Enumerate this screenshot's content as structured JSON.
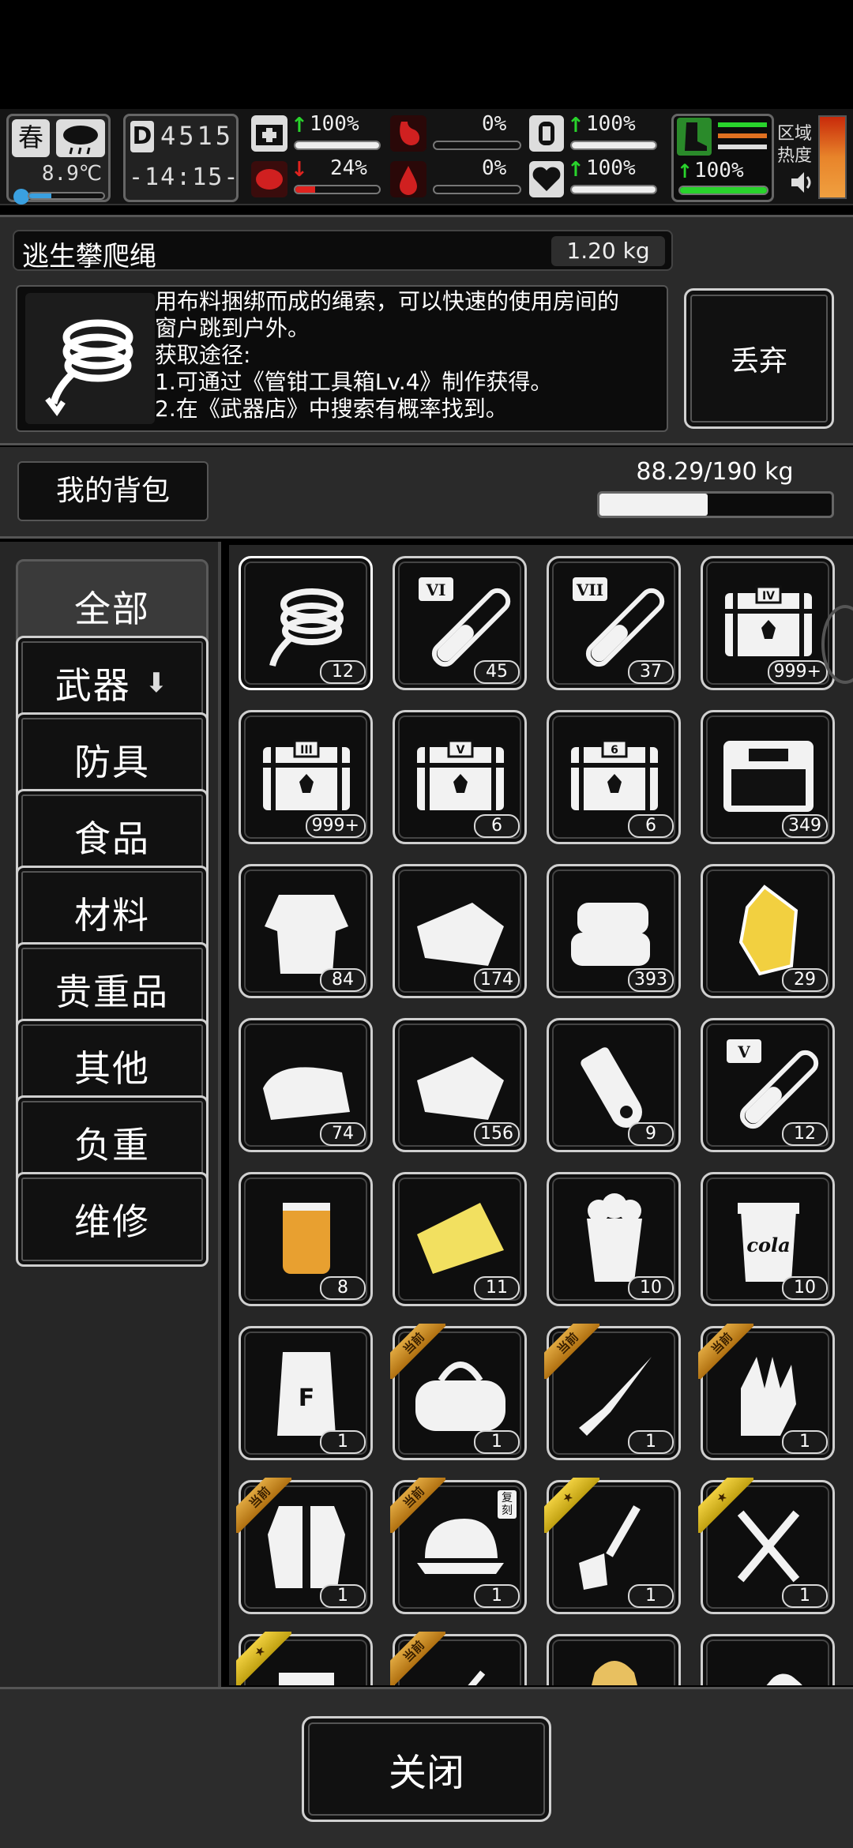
{
  "hud": {
    "season": "春",
    "temperature": "8.9℃",
    "day": "4515",
    "time": "-14:15-",
    "health_pct": "100%",
    "health_level": 1.0,
    "mental_pct": "24%",
    "mental_level": 0.24,
    "hunger_pct": "0%",
    "hunger_level": 0.0,
    "thirst_pct": "0%",
    "thirst_level": 0.0,
    "stamina_pct": "100%",
    "stamina_level": 1.0,
    "mood_pct": "100%",
    "mood_level": 1.0,
    "legs_pct": "100%",
    "legs_level": 1.0,
    "region_label": "区域热度",
    "colors": {
      "green": "#29d32c",
      "red": "#e0231f"
    }
  },
  "item": {
    "name": "逃生攀爬绳",
    "weight": "1.20 kg",
    "desc_lines": [
      "用布料捆绑而成的绳索，可以快速的使用房间的",
      "窗户跳到户外。",
      "获取途径:",
      "1.可通过《管钳工具箱Lv.4》制作获得。",
      "2.在《武器店》中搜索有概率找到。"
    ],
    "discard_label": "丢弃",
    "icon": "rope-icon"
  },
  "bag": {
    "title": "我的背包",
    "weight_text": "88.29/190 kg",
    "weight_fraction": 0.4647
  },
  "categories": [
    {
      "label": "全部",
      "active": true
    },
    {
      "label": "武器",
      "active": false,
      "arrow": true
    },
    {
      "label": "防具",
      "active": false
    },
    {
      "label": "食品",
      "active": false
    },
    {
      "label": "材料",
      "active": false
    },
    {
      "label": "贵重品",
      "active": false
    },
    {
      "label": "其他",
      "active": false
    },
    {
      "label": "负重",
      "active": false
    },
    {
      "label": "维修",
      "active": false
    }
  ],
  "items": [
    {
      "icon": "rope",
      "count": "12",
      "selected": true
    },
    {
      "icon": "potion-VI",
      "count": "45"
    },
    {
      "icon": "potion-VII",
      "count": "37"
    },
    {
      "icon": "chest-IV",
      "count": "999+"
    },
    {
      "icon": "chest-III",
      "count": "999+"
    },
    {
      "icon": "chest-V",
      "count": "6"
    },
    {
      "icon": "chest-6",
      "count": "6"
    },
    {
      "icon": "toolbox",
      "count": "349"
    },
    {
      "icon": "ragged-shirt",
      "count": "84"
    },
    {
      "icon": "cloth-scraps",
      "count": "174"
    },
    {
      "icon": "folded-towels",
      "count": "393"
    },
    {
      "icon": "gold-ore",
      "count": "29"
    },
    {
      "icon": "folded-cloth",
      "count": "74"
    },
    {
      "icon": "cloth-sheet",
      "count": "156"
    },
    {
      "icon": "paper-roll",
      "count": "9"
    },
    {
      "icon": "potion-V",
      "count": "12"
    },
    {
      "icon": "tape-roll",
      "count": "8"
    },
    {
      "icon": "yellow-cloth",
      "count": "11"
    },
    {
      "icon": "popcorn",
      "count": "10"
    },
    {
      "icon": "cola",
      "count": "10",
      "text": "cola"
    },
    {
      "icon": "flour-bag",
      "count": "1",
      "text": "F"
    },
    {
      "icon": "duffel-bag",
      "count": "1",
      "tag": "当前"
    },
    {
      "icon": "knife",
      "count": "1",
      "tag": "当前"
    },
    {
      "icon": "gloves",
      "count": "1",
      "tag": "当前"
    },
    {
      "icon": "vest",
      "count": "1",
      "tag": "当前"
    },
    {
      "icon": "cap",
      "count": "1",
      "tag": "当前",
      "badge": "复刻"
    },
    {
      "icon": "shovel",
      "count": "1",
      "tag": "★"
    },
    {
      "icon": "hammer-wrench",
      "count": "1",
      "tag": "★"
    },
    {
      "icon": "box-partial",
      "count": "",
      "tag": "★"
    },
    {
      "icon": "stick-partial",
      "count": "",
      "tag": "当前"
    },
    {
      "icon": "gold-partial",
      "count": ""
    },
    {
      "icon": "tube-partial",
      "count": ""
    }
  ],
  "close_label": "关闭"
}
